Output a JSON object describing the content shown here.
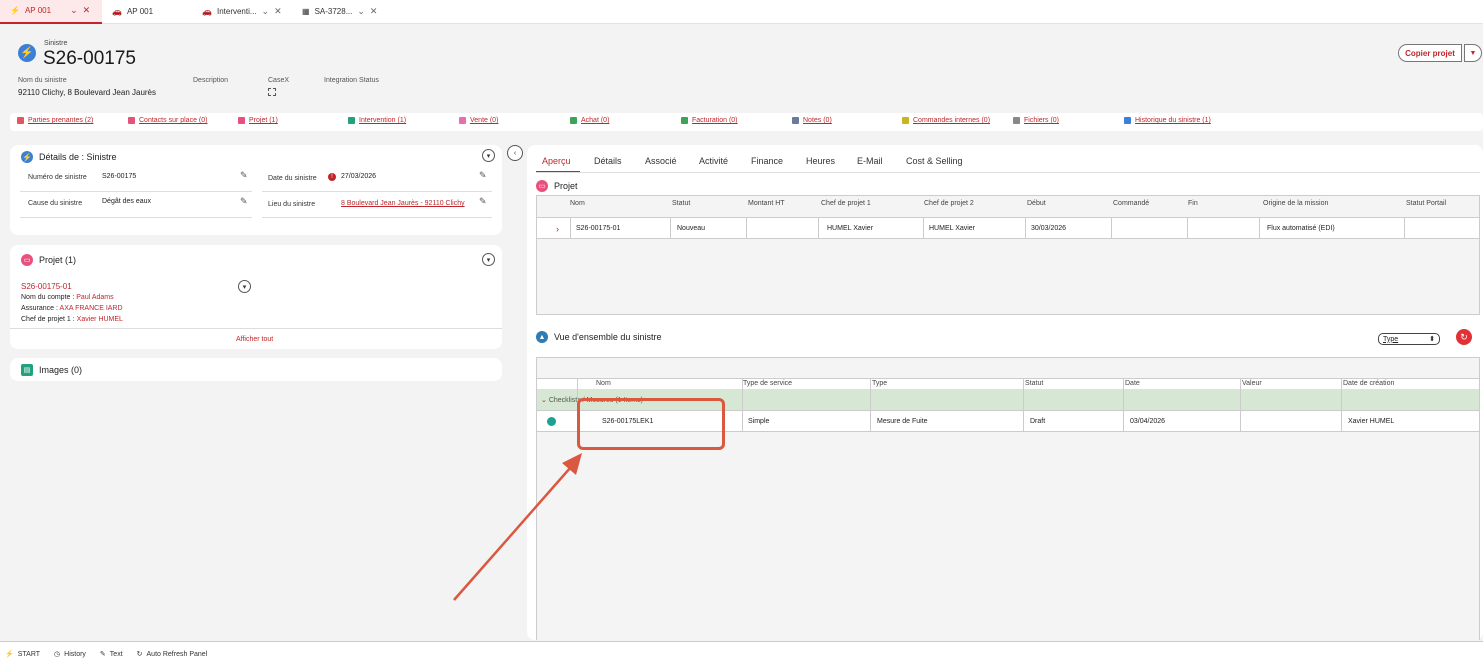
{
  "tabs": [
    {
      "label": "AP 001",
      "icon": "bolt-icon"
    },
    {
      "label": "AP 001",
      "icon": "car-icon"
    },
    {
      "label": "Interventi...",
      "icon": "car-icon"
    },
    {
      "label": "SA-3728...",
      "icon": "calendar-icon"
    }
  ],
  "header": {
    "object_type": "Sinistre",
    "title": "S26-00175",
    "copy_button": "Copier projet",
    "fields": {
      "nom_label": "Nom du sinistre",
      "nom_value": "92110 Clichy, 8 Boulevard Jean Jaurès",
      "description_label": "Description",
      "casex_label": "CaseX",
      "integration_label": "Integration Status"
    }
  },
  "related_links": [
    {
      "label": "Parties prenantes (2)",
      "color": "#e25562"
    },
    {
      "label": "Contacts sur place (0)",
      "color": "#e2557a"
    },
    {
      "label": "Projet (1)",
      "color": "#e8517e"
    },
    {
      "label": "Intervention (1)",
      "color": "#23a17f"
    },
    {
      "label": "Vente (0)",
      "color": "#e76fb0"
    },
    {
      "label": "Achat (0)",
      "color": "#3aa55a"
    },
    {
      "label": "Facturation (0)",
      "color": "#3aa55a"
    },
    {
      "label": "Notes (0)",
      "color": "#6b7a99"
    },
    {
      "label": "Commandes internes (0)",
      "color": "#c9b422"
    },
    {
      "label": "Fichiers (0)",
      "color": "#888888"
    },
    {
      "label": "Historique du sinistre (1)",
      "color": "#3b80d6"
    }
  ],
  "details": {
    "title": "Détails de : Sinistre",
    "numero_label": "Numéro de sinistre",
    "numero_value": "S26-00175",
    "cause_label": "Cause du sinistre",
    "cause_value": "Dégât des eaux",
    "date_label": "Date du sinistre",
    "date_value": "27/03/2026",
    "lieu_label": "Lieu du sinistre",
    "lieu_value": "8 Boulevard Jean Jaurès - 92110 Clichy"
  },
  "projet_card": {
    "title": "Projet (1)",
    "project_link": "S26-00175-01",
    "compte_label": "Nom du compte :",
    "compte_value": "Paul Adams",
    "assurance_label": "Assurance :",
    "assurance_value": "AXA FRANCE IARD",
    "chef_label": "Chef de projet 1 :",
    "chef_value": "Xavier HUMEL",
    "show_all": "Afficher tout"
  },
  "images_card": {
    "title": "Images (0)"
  },
  "right_tabs": [
    "Aperçu",
    "Détails",
    "Associé",
    "Activité",
    "Finance",
    "Heures",
    "E-Mail",
    "Cost & Selling"
  ],
  "projet_table": {
    "title": "Projet",
    "headers": [
      "Nom",
      "Statut",
      "Montant HT",
      "Chef de projet 1",
      "Chef de projet 2",
      "Début",
      "Commandé",
      "Fin",
      "Origine de la mission",
      "Statut Portail"
    ],
    "row": [
      "S26-00175-01",
      "Nouveau",
      "",
      "HUMEL Xavier",
      "HUMEL Xavier",
      "30/03/2026",
      "",
      "",
      "Flux automatisé (EDI)",
      ""
    ]
  },
  "overview": {
    "title": "Vue d'ensemble du sinistre",
    "type_select": "Type",
    "headers": [
      "Nom",
      "Type de service",
      "Type",
      "Statut",
      "Date",
      "Valeur",
      "Date de création"
    ],
    "group_label": "Checklists / Mesures (1 Items)",
    "row": [
      "S26-00175LEK1",
      "Simple",
      "Mesure de Fuite",
      "Draft",
      "03/04/2026",
      "",
      "Xavier HUMEL"
    ]
  },
  "bottom_bar": [
    "START",
    "History",
    "Text",
    "Auto Refresh Panel"
  ],
  "colors": {
    "accent": "#c0262b",
    "highlight": "#d9583f",
    "group_bg": "#d6e8d3"
  }
}
